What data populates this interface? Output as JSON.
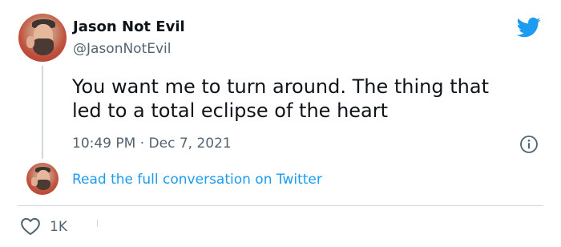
{
  "author": {
    "name": "Jason Not Evil",
    "handle": "@JasonNotEvil"
  },
  "tweet": {
    "text_lines": [
      "You want me to turn around.  The thing that",
      "led to a total eclipse of the heart"
    ],
    "timestamp": "10:49 PM · Dec 7, 2021"
  },
  "reply": {
    "link_text": "Read the full conversation on Twitter"
  },
  "actions": {
    "like_count": "1K"
  },
  "icons": {
    "brand": "twitter-bird-icon",
    "info": "info-icon",
    "like": "heart-icon"
  },
  "colors": {
    "brand_blue": "#1d9bf0",
    "secondary_text": "#536471",
    "primary_text": "#0f1419",
    "divider": "#cfd9de"
  }
}
